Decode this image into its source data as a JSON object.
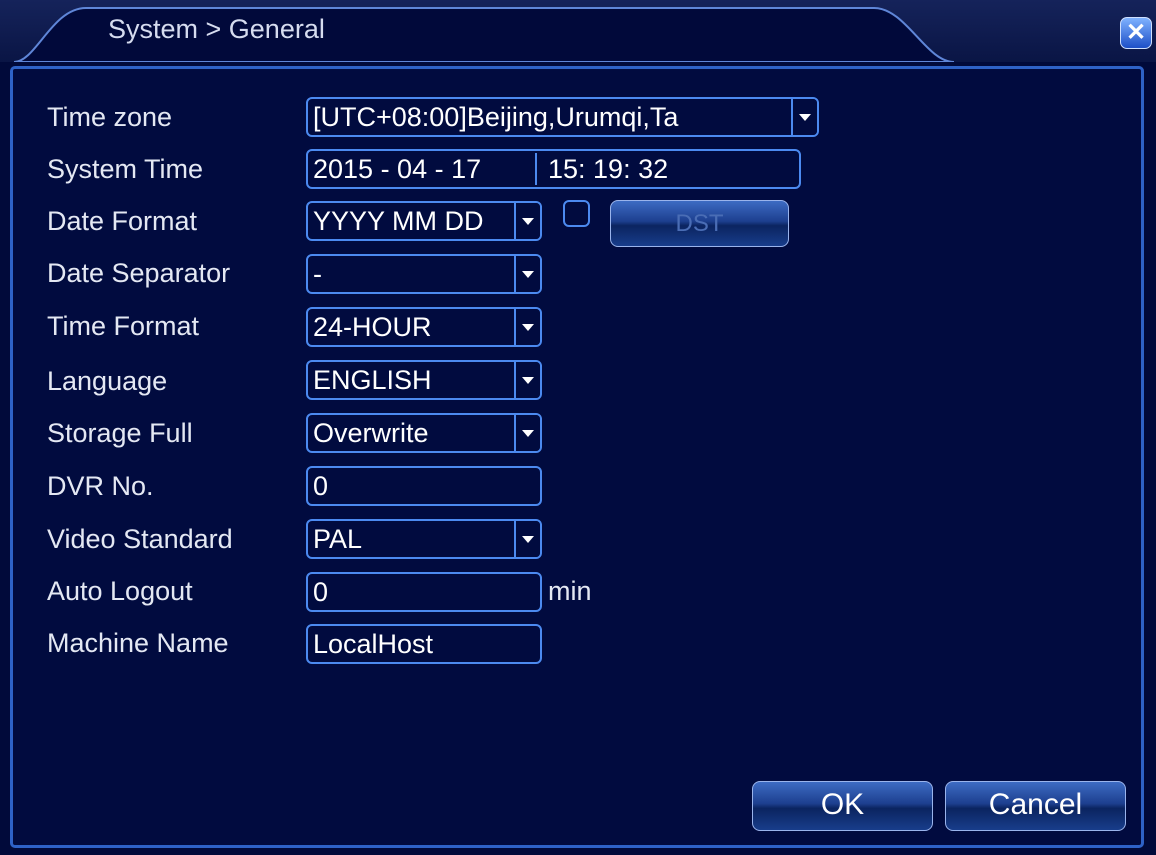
{
  "window": {
    "title": "System > General",
    "close_symbol": "✕"
  },
  "form": {
    "time_zone": {
      "label": "Time zone",
      "value": "[UTC+08:00]Beijing,Urumqi,Ta"
    },
    "system_time": {
      "label": "System Time",
      "date": "2015 - 04 - 17",
      "time": "15: 19: 32"
    },
    "date_format": {
      "label": "Date Format",
      "value": "YYYY MM DD"
    },
    "dst": {
      "checked": false,
      "button_label": "DST"
    },
    "date_separator": {
      "label": "Date Separator",
      "value": "-"
    },
    "time_format": {
      "label": "Time Format",
      "value": "24-HOUR"
    },
    "language": {
      "label": "Language",
      "value": "ENGLISH"
    },
    "storage_full": {
      "label": "Storage Full",
      "value": "Overwrite"
    },
    "dvr_no": {
      "label": "DVR No.",
      "value": "0"
    },
    "video_standard": {
      "label": "Video Standard",
      "value": "PAL"
    },
    "auto_logout": {
      "label": "Auto Logout",
      "value": "0",
      "unit": "min"
    },
    "machine_name": {
      "label": "Machine Name",
      "value": "LocalHost"
    }
  },
  "buttons": {
    "ok": "OK",
    "cancel": "Cancel"
  },
  "icons": {
    "close": "close-icon",
    "dropdown": "chevron-down-icon"
  }
}
